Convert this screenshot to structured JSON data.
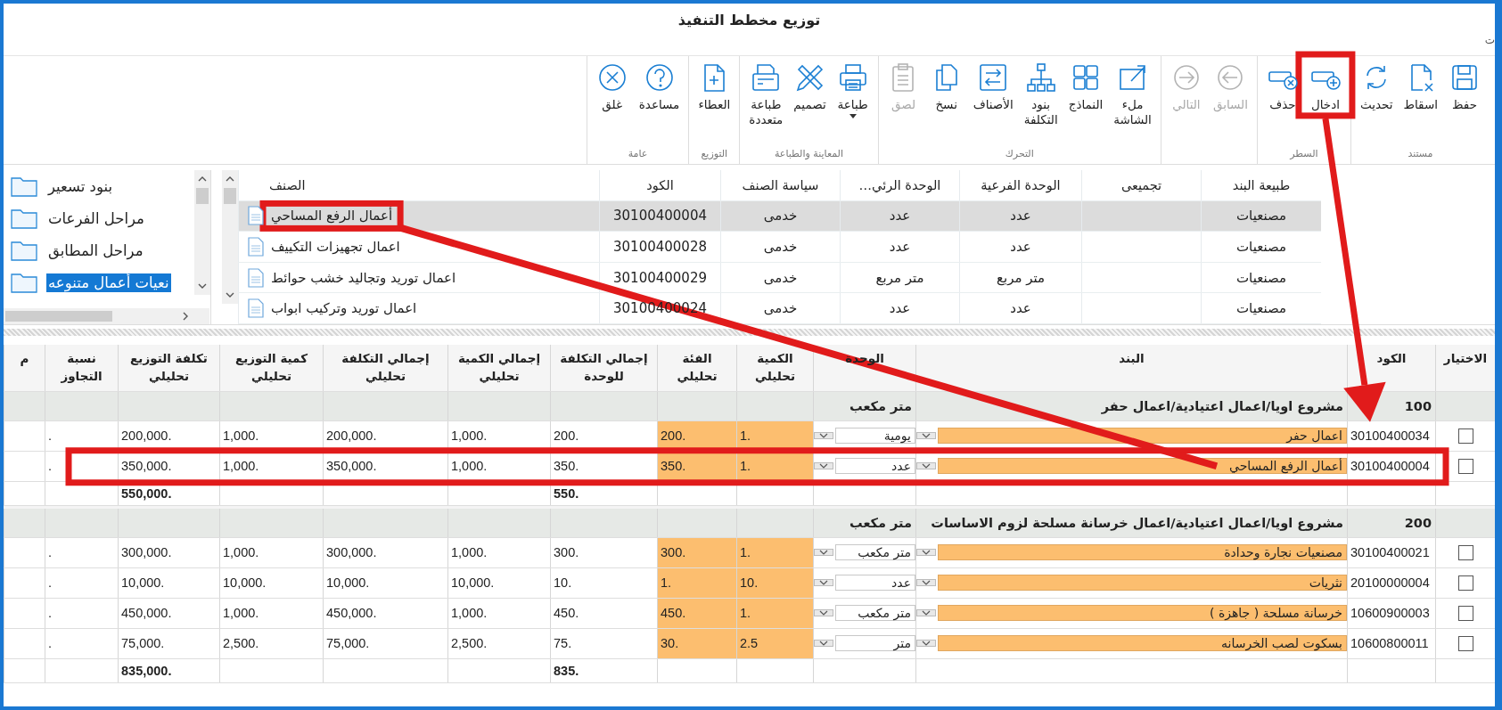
{
  "window": {
    "title": "توزيع مخطط التنفيذ",
    "subtitle": "ت"
  },
  "ribbon": {
    "groups": [
      {
        "label": "مستند",
        "buttons": [
          {
            "label": "حفظ",
            "disabled": false,
            "has_menu": false
          },
          {
            "label": "اسقاط",
            "disabled": false,
            "has_menu": false
          },
          {
            "label": "تحديث",
            "disabled": false,
            "has_menu": false
          }
        ]
      },
      {
        "label": "السطر",
        "buttons": [
          {
            "label": "ادخال",
            "disabled": false,
            "has_menu": false
          },
          {
            "label": "حذف",
            "disabled": false,
            "has_menu": false
          }
        ]
      },
      {
        "buttons": [
          {
            "label": "السابق",
            "disabled": true,
            "has_menu": false
          },
          {
            "label": "التالي",
            "disabled": true,
            "has_menu": false
          }
        ]
      },
      {
        "label": "التحرك",
        "buttons": [
          {
            "label": "ملء الشاشة",
            "disabled": false,
            "has_menu": false
          },
          {
            "label": "النماذج",
            "disabled": false,
            "has_menu": false
          },
          {
            "label": "بنود التكلفة",
            "disabled": false,
            "has_menu": false
          },
          {
            "label": "الأصناف",
            "disabled": false,
            "has_menu": false
          },
          {
            "label": "نسخ",
            "disabled": false,
            "has_menu": false
          },
          {
            "label": "لصق",
            "disabled": true,
            "has_menu": false
          }
        ]
      },
      {
        "label": "المعاينة والطباعة",
        "buttons": [
          {
            "label": "طباعة",
            "disabled": false,
            "has_menu": true
          },
          {
            "label": "تصميم",
            "disabled": false,
            "has_menu": false
          },
          {
            "label": "طباعة متعددة",
            "disabled": false,
            "has_menu": false
          }
        ]
      },
      {
        "label": "التوزيع",
        "buttons": [
          {
            "label": "العطاء",
            "disabled": false,
            "has_menu": false
          }
        ]
      },
      {
        "label": "عامة",
        "buttons": [
          {
            "label": "مساعدة",
            "disabled": false,
            "has_menu": false
          },
          {
            "label": "غلق",
            "disabled": false,
            "has_menu": false
          }
        ]
      }
    ]
  },
  "tree": {
    "items": [
      {
        "label": "بنود تسعير",
        "selected": false
      },
      {
        "label": "مراحل الفرعات",
        "selected": false
      },
      {
        "label": "مراحل المطابق",
        "selected": false
      },
      {
        "label": "نعيات أعمال متنوعه",
        "selected": true
      }
    ]
  },
  "items_grid": {
    "columns": [
      "طبيعة البند",
      "تجميعى",
      "الوحدة الفرعية",
      "الوحدة الرئي…",
      "سياسة الصنف",
      "الكود",
      "الصنف"
    ],
    "rows": [
      {
        "selected": true,
        "nature": "مصنعيات",
        "sub_unit": "عدد",
        "main_unit": "عدد",
        "policy": "خدمى",
        "code": "30100400004",
        "name": "أعمال الرفع المساحي"
      },
      {
        "selected": false,
        "nature": "مصنعيات",
        "sub_unit": "عدد",
        "main_unit": "عدد",
        "policy": "خدمى",
        "code": "30100400028",
        "name": "اعمال تجهيزات التكييف"
      },
      {
        "selected": false,
        "nature": "مصنعيات",
        "sub_unit": "متر مربع",
        "main_unit": "متر مربع",
        "policy": "خدمى",
        "code": "30100400029",
        "name": "اعمال توريد وتجاليد خشب حوائط"
      },
      {
        "selected": false,
        "nature": "مصنعيات",
        "sub_unit": "عدد",
        "main_unit": "عدد",
        "policy": "خدمى",
        "code": "30100400024",
        "name": "اعمال توريد وتركيب ابواب"
      }
    ]
  },
  "distribution": {
    "columns": [
      [
        "الاختيار"
      ],
      [
        "الكود"
      ],
      [
        "البند"
      ],
      [
        "الوحدة"
      ],
      [
        "الكمية",
        "تحليلي"
      ],
      [
        "الفئة",
        "تحليلي"
      ],
      [
        "إجمالي التكلفة",
        "للوحدة"
      ],
      [
        "إجمالي الكمية",
        "تحليلي"
      ],
      [
        "إجمالي التكلفة",
        "تحليلي"
      ],
      [
        "كمية التوزيع",
        "تحليلي"
      ],
      [
        "تكلفة التوزيع",
        "تحليلي"
      ],
      [
        "نسبة",
        "التجاوز"
      ],
      [
        "م"
      ]
    ],
    "groups": [
      {
        "code": "100",
        "title": "مشروع اويا/اعمال اعتيادية/اعمال حفر",
        "unit": "متر مكعب",
        "rows": [
          {
            "checked": false,
            "code": "30100400034",
            "item": "اعمال حفر",
            "unit": "يومية",
            "qty": "1.",
            "rate": "200.",
            "unit_cost": "200.",
            "total_qty": "1,000.",
            "total_cost": "200,000.",
            "dist_qty": "1,000.",
            "dist_cost": "200,000.",
            "overrun": "."
          },
          {
            "checked": false,
            "code": "30100400004",
            "item": "أعمال الرفع المساحي",
            "unit": "عدد",
            "qty": "1.",
            "rate": "350.",
            "unit_cost": "350.",
            "total_qty": "1,000.",
            "total_cost": "350,000.",
            "dist_qty": "1,000.",
            "dist_cost": "350,000.",
            "overrun": "."
          }
        ],
        "total_unit_cost": "550.",
        "total_dist_cost": "550,000."
      },
      {
        "code": "200",
        "title": "مشروع اويا/اعمال اعتيادية/اعمال خرسانة مسلحة لزوم الاساسات",
        "unit": "متر مكعب",
        "rows": [
          {
            "checked": false,
            "code": "30100400021",
            "item": "مصنعيات نجارة وحدادة",
            "unit": "متر مكعب",
            "qty": "1.",
            "rate": "300.",
            "unit_cost": "300.",
            "total_qty": "1,000.",
            "total_cost": "300,000.",
            "dist_qty": "1,000.",
            "dist_cost": "300,000.",
            "overrun": "."
          },
          {
            "checked": false,
            "code": "20100000004",
            "item": "نثريات",
            "unit": "عدد",
            "qty": "10.",
            "rate": "1.",
            "unit_cost": "10.",
            "total_qty": "10,000.",
            "total_cost": "10,000.",
            "dist_qty": "10,000.",
            "dist_cost": "10,000.",
            "overrun": "."
          },
          {
            "checked": false,
            "code": "10600900003",
            "item": "خرسانة مسلحة ( جاهزة )",
            "unit": "متر مكعب",
            "qty": "1.",
            "rate": "450.",
            "unit_cost": "450.",
            "total_qty": "1,000.",
            "total_cost": "450,000.",
            "dist_qty": "1,000.",
            "dist_cost": "450,000.",
            "overrun": "."
          },
          {
            "checked": false,
            "code": "10600800011",
            "item": "بسكوت لصب الخرسانه",
            "unit": "متر",
            "qty": "2.5",
            "rate": "30.",
            "unit_cost": "75.",
            "total_qty": "2,500.",
            "total_cost": "75,000.",
            "dist_qty": "2,500.",
            "dist_cost": "75,000.",
            "overrun": "."
          }
        ],
        "total_unit_cost": "835.",
        "total_dist_cost": "835,000."
      }
    ]
  },
  "annotations": [
    {
      "kind": "box"
    },
    {
      "kind": "box"
    },
    {
      "kind": "box"
    },
    {
      "kind": "arrow"
    },
    {
      "kind": "line"
    }
  ]
}
